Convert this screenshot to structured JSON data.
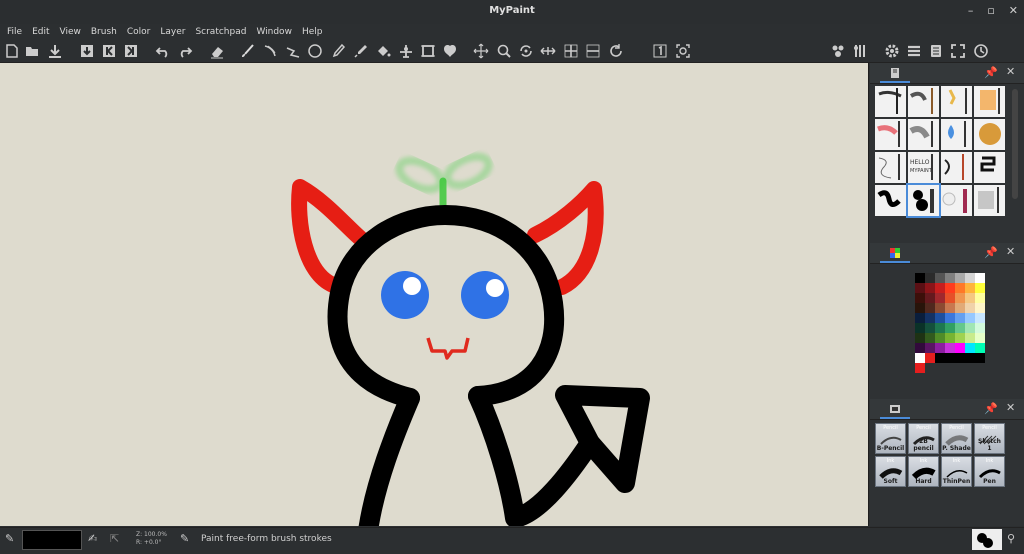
{
  "window": {
    "title": "MyPaint"
  },
  "window_buttons": {
    "minimize": "–",
    "maximize": "▫",
    "close": "✕"
  },
  "menu": [
    "File",
    "Edit",
    "View",
    "Brush",
    "Color",
    "Layer",
    "Scratchpad",
    "Window",
    "Help"
  ],
  "toolbar_icons": [
    "new-file-icon",
    "open-file-icon",
    "save-file-icon",
    "open-previous-icon",
    "open-first-icon",
    "open-next-icon",
    "undo-icon",
    "redo-icon",
    "eraser-icon",
    "freehand-brush-icon",
    "inking-icon",
    "line-icon",
    "ellipse-icon",
    "fill-pen-icon",
    "color-picker-icon",
    "flood-fill-icon",
    "layer-move-icon",
    "frame-icon",
    "symmetry-icon",
    "pan-view-icon",
    "zoom-view-icon",
    "rotate-view-icon",
    "mirror-view-icon",
    "zoom-in-icon",
    "zoom-out-icon",
    "rotate-reset-icon",
    "reset-zoom-icon",
    "fit-view-icon",
    "brush-icons-icon",
    "brush-settings-icon",
    "preferences-icon",
    "layers-icon",
    "scratchpad-icon",
    "fullscreen-icon",
    "history-icon"
  ],
  "panels": {
    "brushes": {
      "icon": "brush-book-icon",
      "pin": "pin-icon",
      "close": "✕"
    },
    "palette": {
      "icon": "palette-icon",
      "pin": "pin-icon",
      "close": "✕"
    },
    "presets": {
      "icon": "preset-icon",
      "pin": "pin-icon",
      "close": "✕"
    }
  },
  "brush_presets": [
    {
      "top": "Pencil",
      "label": "B-Pencil"
    },
    {
      "top": "Pencil",
      "label": "2B pencil"
    },
    {
      "top": "Pencil",
      "label": "P. Shade"
    },
    {
      "top": "Pencil",
      "label": "Sketch 1"
    },
    {
      "top": "Ink",
      "label": "Soft"
    },
    {
      "top": "Ink",
      "label": "Hard"
    },
    {
      "top": "Ink",
      "label": "ThinPen"
    },
    {
      "top": "Ink",
      "label": "Pen"
    }
  ],
  "palette_colors": [
    "#000000",
    "#2b2b2b",
    "#555555",
    "#808080",
    "#aaaaaa",
    "#d5d5d5",
    "#ffffff",
    "#5a0f14",
    "#8c1419",
    "#c81e1e",
    "#ff3c1e",
    "#ff7828",
    "#ffb43c",
    "#ffff3c",
    "#3c0f0a",
    "#64191e",
    "#a0282d",
    "#e65028",
    "#f09650",
    "#f5c882",
    "#ffffa0",
    "#28140a",
    "#50281e",
    "#8c4b32",
    "#c87850",
    "#e1aa78",
    "#f0d2aa",
    "#fff5c8",
    "#0a1e3c",
    "#143264",
    "#1e50a0",
    "#3c78dc",
    "#64a0f0",
    "#96c8ff",
    "#c8e6ff",
    "#0a3228",
    "#14503c",
    "#1e7850",
    "#32a064",
    "#64c88c",
    "#a0e6b4",
    "#d2fadc",
    "#1e3214",
    "#325a1e",
    "#508c28",
    "#78b432",
    "#a0d250",
    "#c8eb8c",
    "#e6ffc8",
    "#320a3c",
    "#5a1464",
    "#8c1ea0",
    "#c832dc",
    "#ff00ff",
    "#00e6ff",
    "#00ffb4",
    "#ffffff",
    "#e61e1e",
    "#000000",
    "#000000",
    "#000000",
    "#000000",
    "#000000",
    "#e61e1e"
  ],
  "status": {
    "zoom": "Z: 100.0%",
    "rotation": "R: +0.0°",
    "message": "Paint free-form brush strokes",
    "current_color": "#000000"
  }
}
